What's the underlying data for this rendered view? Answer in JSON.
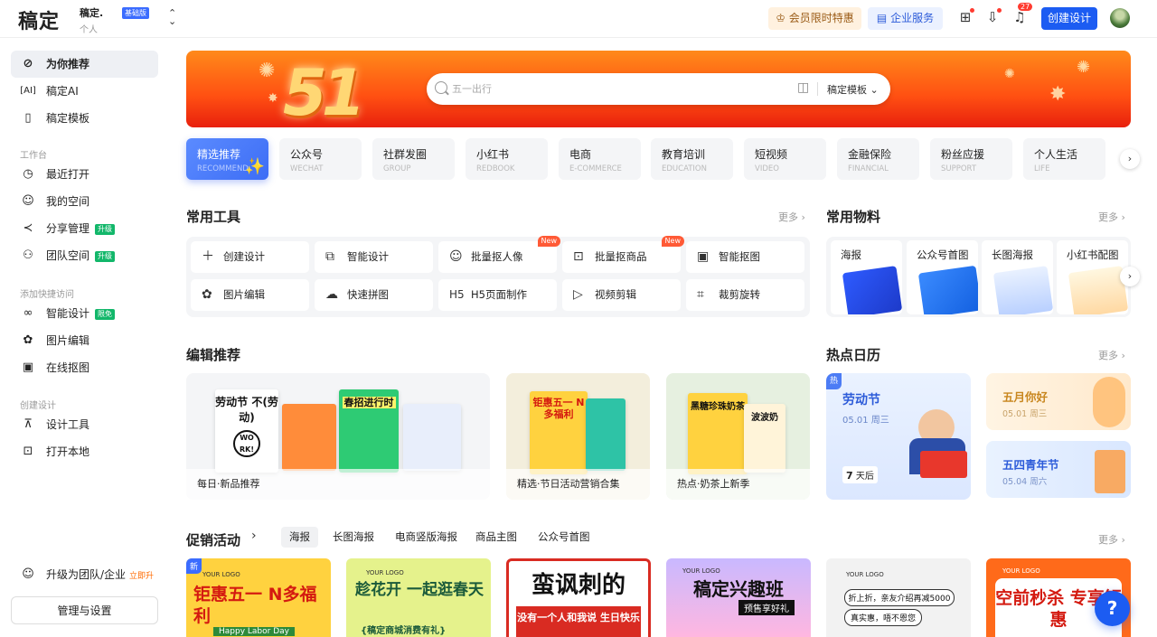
{
  "header": {
    "logo": "稿定",
    "account_name": "稿定.",
    "account_type": "个人",
    "plan_badge": "基础版",
    "vip_label": "会员限时特惠",
    "enterprise_label": "企业服务",
    "notification_count": "27",
    "create_label": "创建设计"
  },
  "sidebar": {
    "items": [
      {
        "label": "为你推荐"
      },
      {
        "label": "稿定AI"
      },
      {
        "label": "稿定模板"
      }
    ],
    "workspace_title": "工作台",
    "workspace": [
      {
        "label": "最近打开"
      },
      {
        "label": "我的空间"
      },
      {
        "label": "分享管理",
        "tag": "升级"
      },
      {
        "label": "团队空间",
        "tag": "升级"
      }
    ],
    "quick_title": "添加快捷访问",
    "quick": [
      {
        "label": "智能设计",
        "tag": "限免"
      },
      {
        "label": "图片编辑"
      },
      {
        "label": "在线抠图"
      }
    ],
    "create_title": "创建设计",
    "create": [
      {
        "label": "设计工具"
      },
      {
        "label": "打开本地"
      }
    ],
    "upgrade_label": "升级为团队/企业",
    "upgrade_tag": "立即升级",
    "settings_label": "管理与设置"
  },
  "banner": {
    "number": "51",
    "search_placeholder": "五一出行",
    "template_select": "稿定模板"
  },
  "categories": [
    {
      "cn": "精选推荐",
      "en": "RECOMMEND"
    },
    {
      "cn": "公众号",
      "en": "WECHAT"
    },
    {
      "cn": "社群发圈",
      "en": "GROUP"
    },
    {
      "cn": "小红书",
      "en": "REDBOOK"
    },
    {
      "cn": "电商",
      "en": "E-COMMERCE"
    },
    {
      "cn": "教育培训",
      "en": "EDUCATION"
    },
    {
      "cn": "短视频",
      "en": "VIDEO"
    },
    {
      "cn": "金融保险",
      "en": "FINANCIAL"
    },
    {
      "cn": "粉丝应援",
      "en": "SUPPORT"
    },
    {
      "cn": "个人生活",
      "en": "LIFE"
    }
  ],
  "tools": {
    "title": "常用工具",
    "more": "更多",
    "new_tag": "New",
    "items": [
      {
        "label": "创建设计"
      },
      {
        "label": "智能设计"
      },
      {
        "label": "批量抠人像"
      },
      {
        "label": "批量抠商品"
      },
      {
        "label": "智能抠图"
      },
      {
        "label": "图片编辑"
      },
      {
        "label": "快速拼图"
      },
      {
        "label": "H5页面制作"
      },
      {
        "label": "视频剪辑"
      },
      {
        "label": "裁剪旋转"
      }
    ]
  },
  "materials": {
    "title": "常用物料",
    "more": "更多",
    "items": [
      {
        "label": "海报"
      },
      {
        "label": "公众号首图"
      },
      {
        "label": "长图海报"
      },
      {
        "label": "小红书配图"
      }
    ]
  },
  "editor_picks": {
    "title": "编辑推荐",
    "cards": [
      {
        "caption": "每日·新品推荐"
      },
      {
        "caption": "精选·节日活动营销合集"
      },
      {
        "caption": "热点·奶茶上新季"
      }
    ],
    "poster_texts": {
      "labor": "劳动节 不(劳动)",
      "work": "WO RK!",
      "spring": "春招进行时",
      "wuyi": "钜惠五一 N多福利",
      "milk": "黑糖珍珠奶茶",
      "milk2": "波波奶"
    }
  },
  "calendar": {
    "title": "热点日历",
    "more": "更多",
    "hot_tag": "热",
    "main": {
      "name": "劳动节",
      "date": "05.01 周三",
      "days_num": "7",
      "days_label": "天后"
    },
    "items": [
      {
        "name": "五月你好",
        "date": "05.01 周三"
      },
      {
        "name": "五四青年节",
        "date": "05.04 周六"
      }
    ]
  },
  "promo": {
    "title": "促销活动",
    "more": "更多",
    "tabs": [
      {
        "label": "海报"
      },
      {
        "label": "长图海报"
      },
      {
        "label": "电商竖版海报"
      },
      {
        "label": "商品主图"
      },
      {
        "label": "公众号首图"
      }
    ],
    "new_tag": "新",
    "cards": [
      {
        "text": "钜惠五一 N多福利",
        "sub": "Happy Labor Day",
        "logo": "YOUR LOGO"
      },
      {
        "text": "趁花开 一起逛春天",
        "sub": "{稿定商城消费有礼}",
        "logo": "YOUR LOGO"
      },
      {
        "text": "蛮讽刺的",
        "sub": "没有一个人和我说 生日快乐",
        "logo": ""
      },
      {
        "text": "稿定兴趣班",
        "sub": "预售享好礼",
        "logo": "YOUR LOGO"
      },
      {
        "text": "折上折，亲友介绍再减5000",
        "sub": "真实惠，唔不恩您",
        "logo": "YOUR LOGO"
      },
      {
        "text": "空前秒杀 专享钜惠",
        "sub": "",
        "logo": "YOUR LOGO"
      }
    ]
  },
  "colors": {
    "accent": "#1c5cf2",
    "banner_orange": "#ff4f12",
    "tag_green": "#12b76a",
    "new_red": "#ff5a36"
  }
}
